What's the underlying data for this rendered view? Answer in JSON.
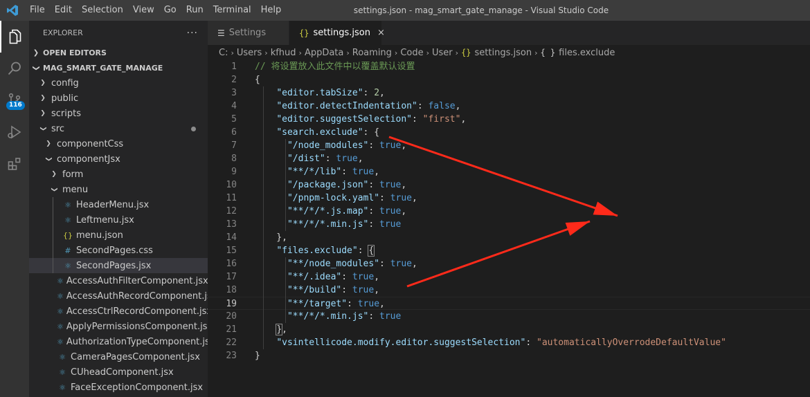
{
  "menu": [
    "File",
    "Edit",
    "Selection",
    "View",
    "Go",
    "Run",
    "Terminal",
    "Help"
  ],
  "window_title": "settings.json - mag_smart_gate_manage - Visual Studio Code",
  "activity": {
    "source_control_badge": "116"
  },
  "sidebar": {
    "title": "EXPLORER",
    "more": "···",
    "open_editors": "OPEN EDITORS",
    "project": "MAG_SMART_GATE_MANAGE",
    "tree": [
      {
        "label": "config",
        "type": "folder",
        "open": false,
        "depth": 1
      },
      {
        "label": "public",
        "type": "folder",
        "open": false,
        "depth": 1
      },
      {
        "label": "scripts",
        "type": "folder",
        "open": false,
        "depth": 1
      },
      {
        "label": "src",
        "type": "folder",
        "open": true,
        "depth": 1,
        "modified": true
      },
      {
        "label": "componentCss",
        "type": "folder",
        "open": false,
        "depth": 2
      },
      {
        "label": "componentJsx",
        "type": "folder",
        "open": true,
        "depth": 2
      },
      {
        "label": "form",
        "type": "folder",
        "open": false,
        "depth": 3
      },
      {
        "label": "menu",
        "type": "folder",
        "open": true,
        "depth": 3
      },
      {
        "label": "HeaderMenu.jsx",
        "type": "jsx",
        "depth": 4
      },
      {
        "label": "Leftmenu.jsx",
        "type": "jsx",
        "depth": 4
      },
      {
        "label": "menu.json",
        "type": "json",
        "depth": 4
      },
      {
        "label": "SecondPages.css",
        "type": "css",
        "depth": 4
      },
      {
        "label": "SecondPages.jsx",
        "type": "jsx",
        "depth": 4,
        "selected": true
      },
      {
        "label": "AccessAuthFilterComponent.jsx",
        "type": "jsx",
        "depth": 3
      },
      {
        "label": "AccessAuthRecordComponent.jsx",
        "type": "jsx",
        "depth": 3
      },
      {
        "label": "AccessCtrlRecordComponent.jsx",
        "type": "jsx",
        "depth": 3
      },
      {
        "label": "ApplyPermissionsComponent.jsx",
        "type": "jsx",
        "depth": 3
      },
      {
        "label": "AuthorizationTypeComponent.jsx",
        "type": "jsx",
        "depth": 3
      },
      {
        "label": "CameraPagesComponent.jsx",
        "type": "jsx",
        "depth": 3
      },
      {
        "label": "CUheadComponent.jsx",
        "type": "jsx",
        "depth": 3
      },
      {
        "label": "FaceExceptionComponent.jsx",
        "type": "jsx",
        "depth": 3
      }
    ]
  },
  "tabs": [
    {
      "label": "Settings",
      "icon": "settings-icon",
      "active": false
    },
    {
      "label": "settings.json",
      "icon": "json-braces-icon",
      "active": true
    }
  ],
  "tab_close": "×",
  "breadcrumb": [
    "C:",
    "Users",
    "kfhud",
    "AppData",
    "Roaming",
    "Code",
    "User",
    "settings.json",
    "files.exclude"
  ],
  "breadcrumb_icons": {
    "settings.json": "{}",
    "files.exclude": "{ }"
  },
  "current_line": 19,
  "code_lines": [
    [
      [
        "c",
        "// 将设置放入此文件中以覆盖默认设置"
      ]
    ],
    [
      [
        "p",
        "{"
      ]
    ],
    [
      [
        "p",
        "    "
      ],
      [
        "k",
        "\"editor.tabSize\""
      ],
      [
        "p",
        ": "
      ],
      [
        "n",
        "2"
      ],
      [
        "p",
        ","
      ]
    ],
    [
      [
        "p",
        "    "
      ],
      [
        "k",
        "\"editor.detectIndentation\""
      ],
      [
        "p",
        ": "
      ],
      [
        "b",
        "false"
      ],
      [
        "p",
        ","
      ]
    ],
    [
      [
        "p",
        "    "
      ],
      [
        "k",
        "\"editor.suggestSelection\""
      ],
      [
        "p",
        ": "
      ],
      [
        "s",
        "\"first\""
      ],
      [
        "p",
        ","
      ]
    ],
    [
      [
        "p",
        "    "
      ],
      [
        "k",
        "\"search.exclude\""
      ],
      [
        "p",
        ": {"
      ]
    ],
    [
      [
        "p",
        "      "
      ],
      [
        "k",
        "\"/node_modules\""
      ],
      [
        "p",
        ": "
      ],
      [
        "b",
        "true"
      ],
      [
        "p",
        ","
      ]
    ],
    [
      [
        "p",
        "      "
      ],
      [
        "k",
        "\"/dist\""
      ],
      [
        "p",
        ": "
      ],
      [
        "b",
        "true"
      ],
      [
        "p",
        ","
      ]
    ],
    [
      [
        "p",
        "      "
      ],
      [
        "k",
        "\"**/*/lib\""
      ],
      [
        "p",
        ": "
      ],
      [
        "b",
        "true"
      ],
      [
        "p",
        ","
      ]
    ],
    [
      [
        "p",
        "      "
      ],
      [
        "k",
        "\"/package.json\""
      ],
      [
        "p",
        ": "
      ],
      [
        "b",
        "true"
      ],
      [
        "p",
        ","
      ]
    ],
    [
      [
        "p",
        "      "
      ],
      [
        "k",
        "\"/pnpm-lock.yaml\""
      ],
      [
        "p",
        ": "
      ],
      [
        "b",
        "true"
      ],
      [
        "p",
        ","
      ]
    ],
    [
      [
        "p",
        "      "
      ],
      [
        "k",
        "\"**/*/*.js.map\""
      ],
      [
        "p",
        ": "
      ],
      [
        "b",
        "true"
      ],
      [
        "p",
        ","
      ]
    ],
    [
      [
        "p",
        "      "
      ],
      [
        "k",
        "\"**/*/*.min.js\""
      ],
      [
        "p",
        ": "
      ],
      [
        "b",
        "true"
      ]
    ],
    [
      [
        "p",
        "    },"
      ]
    ],
    [
      [
        "p",
        "    "
      ],
      [
        "k",
        "\"files.exclude\""
      ],
      [
        "p",
        ": "
      ],
      [
        "box",
        "{"
      ]
    ],
    [
      [
        "p",
        "      "
      ],
      [
        "k",
        "\"**/node_modules\""
      ],
      [
        "p",
        ": "
      ],
      [
        "b",
        "true"
      ],
      [
        "p",
        ","
      ]
    ],
    [
      [
        "p",
        "      "
      ],
      [
        "k",
        "\"**/.idea\""
      ],
      [
        "p",
        ": "
      ],
      [
        "b",
        "true"
      ],
      [
        "p",
        ","
      ]
    ],
    [
      [
        "p",
        "      "
      ],
      [
        "k",
        "\"**/build\""
      ],
      [
        "p",
        ": "
      ],
      [
        "b",
        "true"
      ],
      [
        "p",
        ","
      ]
    ],
    [
      [
        "p",
        "      "
      ],
      [
        "k",
        "\"**/target\""
      ],
      [
        "p",
        ": "
      ],
      [
        "b",
        "true"
      ],
      [
        "p",
        ","
      ]
    ],
    [
      [
        "p",
        "      "
      ],
      [
        "k",
        "\"**/*/*.min.js\""
      ],
      [
        "p",
        ": "
      ],
      [
        "b",
        "true"
      ]
    ],
    [
      [
        "p",
        "    "
      ],
      [
        "box",
        "}"
      ],
      [
        "p",
        ","
      ]
    ],
    [
      [
        "p",
        "    "
      ],
      [
        "k",
        "\"vsintellicode.modify.editor.suggestSelection\""
      ],
      [
        "p",
        ": "
      ],
      [
        "s",
        "\"automaticallyOverrodeDefaultValue\""
      ]
    ],
    [
      [
        "p",
        "}"
      ]
    ]
  ],
  "annotation_color": "#ff2a1a"
}
